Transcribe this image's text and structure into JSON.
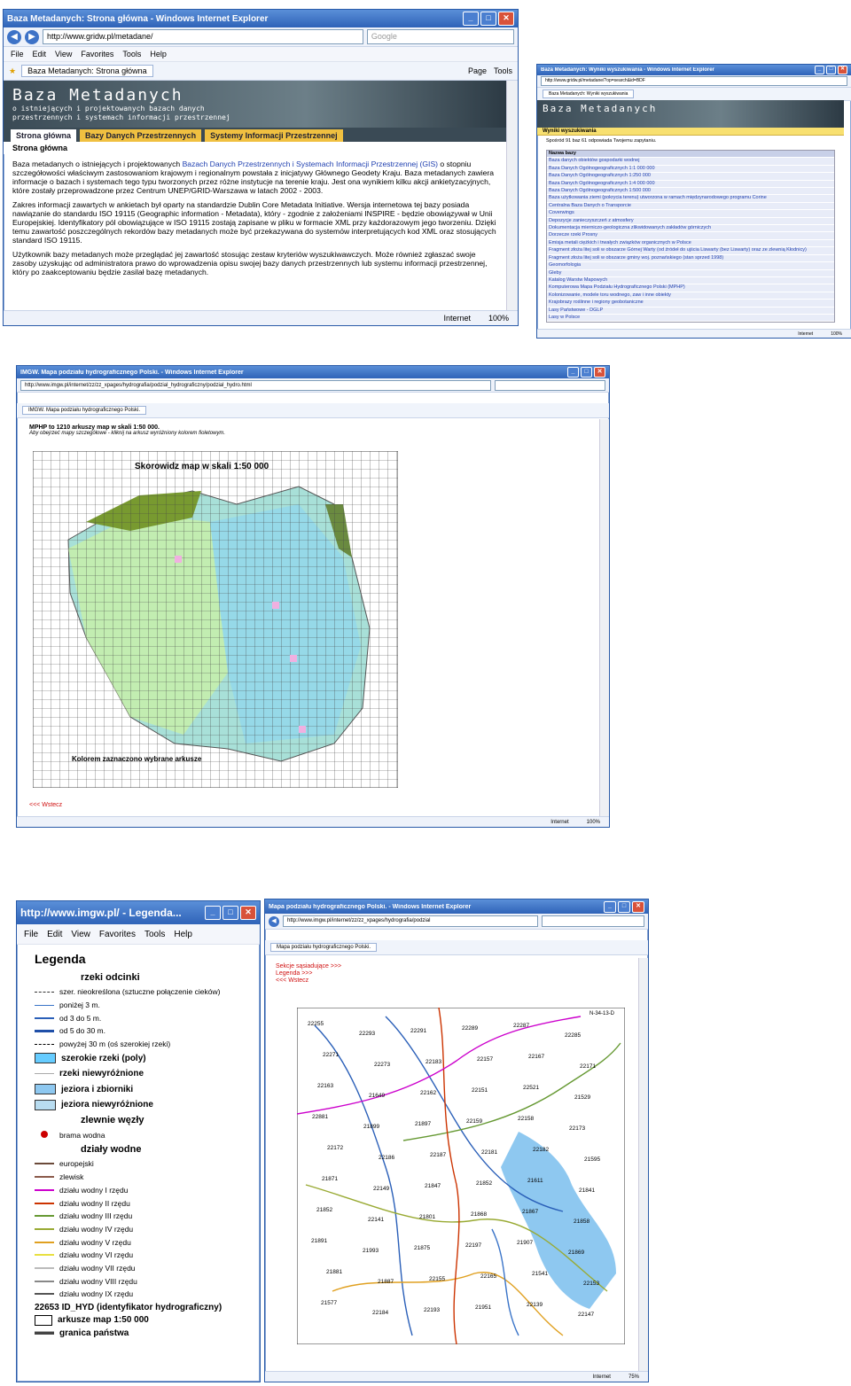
{
  "win1": {
    "title": "Baza Metadanych: Strona główna - Windows Internet Explorer",
    "url": "http://www.gridw.pl/metadane/",
    "search_placeholder": "Google",
    "menu": [
      "File",
      "Edit",
      "View",
      "Favorites",
      "Tools",
      "Help"
    ],
    "tab": "Baza Metadanych: Strona główna",
    "page_label": "Page",
    "tools_label": "Tools",
    "banner_title": "Baza Metadanych",
    "banner_sub1": "o istniejących i projektowanych bazach danych",
    "banner_sub2": "przestrzennych i systemach informacji przestrzennej",
    "site_tabs": [
      "Strona główna",
      "Bazy Danych Przestrzennych",
      "Systemy Informacji Przestrzennej"
    ],
    "subhead": "Strona główna",
    "p1a": "Baza metadanych o istniejących i projektowanych ",
    "p1link": "Bazach Danych Przestrzennych i Systemach Informacji Przestrzennej (GIS)",
    "p1b": " o stopniu szczegółowości właściwym zastosowaniom krajowym i regionalnym powstała z inicjatywy Głównego Geodety Kraju. Baza metadanych zawiera informacje o bazach i systemach tego typu tworzonych przez różne instytucje na terenie kraju. Jest ona wynikiem kilku akcji ankietyzacyjnych, które zostały przeprowadzone przez Centrum UNEP/GRID-Warszawa w latach 2002 - 2003.",
    "p2": "Zakres informacji zawartych w ankietach był oparty na standardzie Dublin Core Metadata Initiative. Wersja internetowa tej bazy posiada nawiązanie do standardu ISO 19115 (Geographic information - Metadata), który - zgodnie z założeniami INSPIRE - będzie obowiązywał w Unii Europejskiej. Identyfikatory pól obowiązujące w ISO 19115 zostają zapisane w pliku w formacie XML przy każdorazowym jego tworzeniu. Dzięki temu zawartość poszczególnych rekordów bazy metadanych może być przekazywana do systemów interpretujących kod XML oraz stosujących standard ISO 19115.",
    "p3": "Użytkownik bazy metadanych może przeglądać jej zawartość stosując zestaw kryteriów wyszukiwawczych. Może również zgłaszać swoje zasoby uzyskując od administratora prawo do wprowadzenia opisu swojej bazy danych przestrzennych lub systemu informacji przestrzennej, który po zaakceptowaniu będzie zasilał bazę metadanych.",
    "zone": "Internet",
    "zoom": "100%"
  },
  "win2": {
    "title": "Baza Metadanych: Wyniki wyszukiwania - Windows Internet Explorer",
    "url": "http://www.gridw.pl/metadane/?op=search&id=BDF",
    "tab": "Baza Metadanych: Wyniki wyszukiwania",
    "banner_title": "Baza Metadanych",
    "subhead": "Wyniki wyszukiwania",
    "summary": "Spośród 91 baz 61 odpowiada Twojemu zapytaniu.",
    "list_header": "Nazwa bazy",
    "results": [
      "Baza danych obiektów gospodarki wodnej",
      "Baza Danych Ogólnogeograficznych 1:1 000 000",
      "Baza Danych Ogólnogeograficznych 1:250 000",
      "Baza Danych Ogólnogeograficznych 1:4 000 000",
      "Baza Danych Ogólnogeograficznych 1:500 000",
      "Baza użytkowania ziemi (pokrycia terenu) utworzona w ramach międzynarodowego programu Corine",
      "Centralna Baza Danych o Transporcie",
      "Coverwings",
      "Depozycje zanieczyszczeń z atmosfery",
      "Dokumentacja mierniczo-geologiczna zlikwidowanych zakładów górniczych",
      "Dorzecze rzeki Prosny",
      "Emisja metali ciężkich i trwałych związków organicznych w Polsce",
      "Fragment złoża litej soli w obszarze Górnej Warty (od źródeł do ujścia Liswarty (bez Liswarty) oraz ze zlewnią Kłodnicy)",
      "Fragment złoża litej soli w obszarze gminy woj. poznańskiego (stan sprzed 1998)",
      "Geomorfologia",
      "Gleby",
      "Katalog Warstw Mapowych",
      "Komputerowa Mapa Podziału Hydrograficznego Polski (MPHP)",
      "Kolonizowanie, modele toru wodnego, zaw i inne obiekty",
      "Krajobrazy roślinne i regiony geobotaniczne",
      "Lasy Państwowe - DGLP",
      "Lasy w Polsce"
    ],
    "zone": "Internet",
    "zoom": "100%"
  },
  "win3": {
    "title": "IMGW. Mapa podziału hydrograficznego Polski. - Windows Internet Explorer",
    "url": "http://www.imgw.pl/internet/zz/zz_xpages/hydrografia/podzial_hydrograficzny/podzial_hydro.html",
    "tab": "IMGW. Mapa podziału hydrograficznego Polski.",
    "heading": "MPHP to 1210 arkuszy map w skali 1:50 000.",
    "hint": "Aby obejrzeć mapy szczegółowe - kliknij na arkusz wyróżniony kolorem fioletowym.",
    "map_title": "Skorowidz map w skali 1:50 000",
    "map_note": "Kolorem zaznaczono wybrane arkusze",
    "back": "<<< Wstecz",
    "zone": "Internet",
    "zoom": "100%"
  },
  "win4": {
    "title": "http://www.imgw.pl/ - Legenda...",
    "menu": [
      "File",
      "Edit",
      "View",
      "Favorites",
      "Tools",
      "Help"
    ],
    "legend_title": "Legenda",
    "sections": {
      "rivers": "rzeki odcinki",
      "basins": "zlewnie węzły",
      "divides": "działy wodne"
    },
    "river_items": [
      "szer. nieokreślona (sztuczne połączenie cieków)",
      "poniżej 3 m.",
      "od 3 do 5 m.",
      "od 5 do 30 m.",
      "powyżej 30 m (oś szerokiej rzeki)"
    ],
    "area_items": [
      "szerokie rzeki (poly)",
      "rzeki niewyróżnione",
      "jeziora i zbiorniki",
      "jeziora niewyróżnione"
    ],
    "node_item": "brama wodna",
    "divide_items": [
      "europejski",
      "zlewisk",
      "działu wodny I rzędu",
      "działu wodny II rzędu",
      "działu wodny III rzędu",
      "działu wodny IV rzędu",
      "działu wodny V rzędu",
      "działu wodny VI rzędu",
      "działu wodny VII rzędu",
      "działu wodny VIII rzędu",
      "działu wodny IX rzędu"
    ],
    "id_item": "22653 ID_HYD (identyfikator hydrograficzny)",
    "sheet_item": "arkusze map 1:50 000",
    "border_item": "granica państwa",
    "colors": {
      "thin": "#3a74c8",
      "medium": "#2a5fb8",
      "thick": "#1f4fa8",
      "wide_poly": "#66ccff",
      "lake": "#8ec8f0",
      "lake_undiff": "#b8dcf0",
      "node": "#cc0000",
      "divides": [
        "#6b4a3a",
        "#8a5a4a",
        "#cc00cc",
        "#cc3300",
        "#669933",
        "#99aa33",
        "#e0a020",
        "#e8e040",
        "#bbbbbb",
        "#888888",
        "#555555"
      ]
    }
  },
  "win5": {
    "title": "Mapa podziału hydrograficznego Polski. - Windows Internet Explorer",
    "url": "http://www.imgw.pl/internet/zz/zz_xpages/hydrografia/podzial",
    "tab": "Mapa podziału hydrograficznego Polski.",
    "link1": "Sekcje sąsiadujące >>>",
    "link2": "Legenda >>>",
    "link3": "<<< Wstecz",
    "sheet_label": "N-34-13-D",
    "ids": [
      "22255",
      "22293",
      "22291",
      "22289",
      "22287",
      "22285",
      "22271",
      "22273",
      "22183",
      "22157",
      "22167",
      "22171",
      "22163",
      "21649",
      "22162",
      "22151",
      "22521",
      "21529",
      "22881",
      "21899",
      "21897",
      "22159",
      "22158",
      "22173",
      "22172",
      "22186",
      "22187",
      "22181",
      "22182",
      "21595",
      "21871",
      "22149",
      "21847",
      "21852",
      "21611",
      "21841",
      "21852",
      "22141",
      "21801",
      "21868",
      "21867",
      "21858",
      "21891",
      "21993",
      "21875",
      "22197",
      "21907",
      "21869",
      "21881",
      "21887",
      "22155",
      "22165",
      "21541",
      "22153",
      "21577",
      "22184",
      "22193",
      "21951",
      "22139",
      "22147"
    ],
    "zone": "Internet",
    "zoom": "75%"
  }
}
